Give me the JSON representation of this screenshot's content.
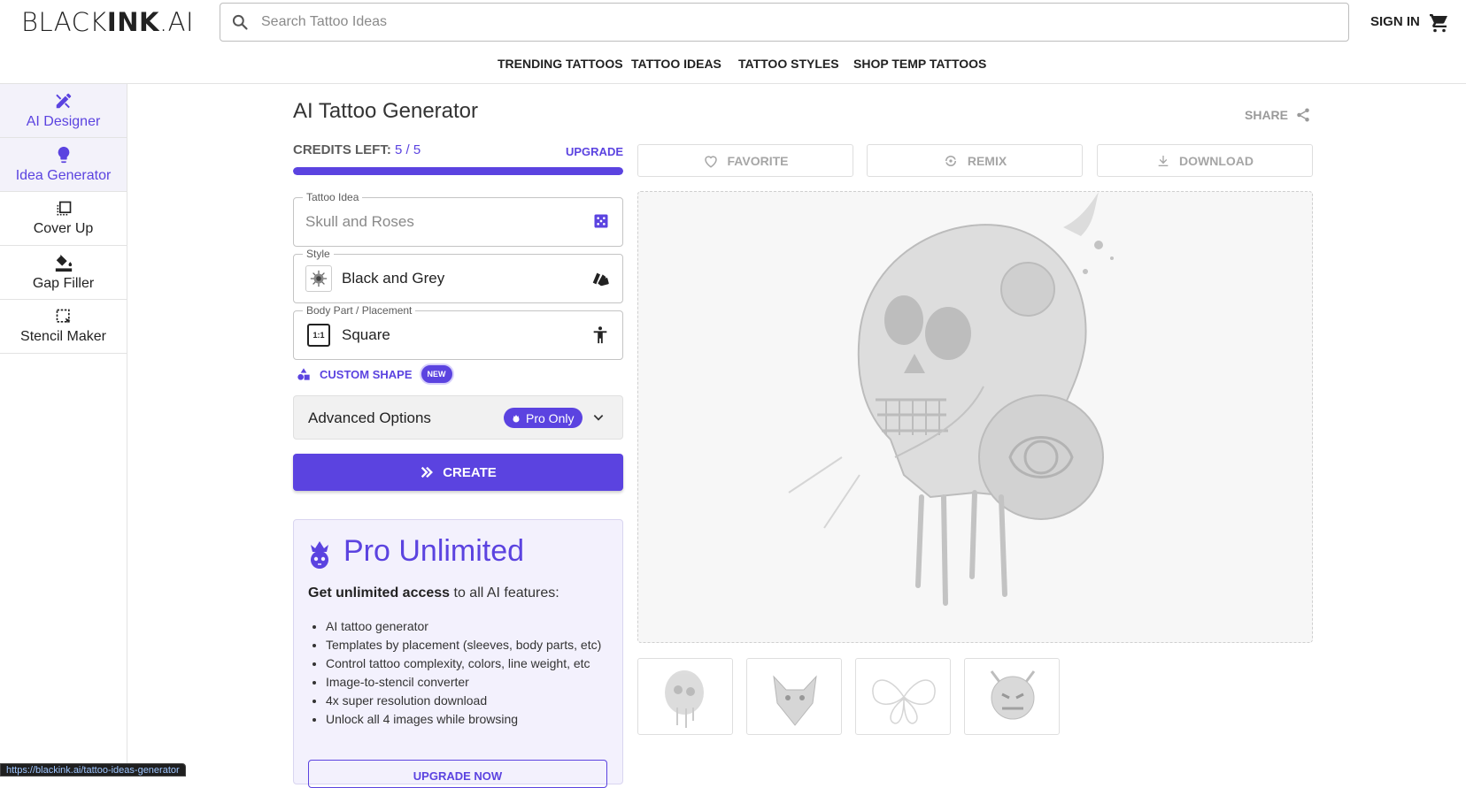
{
  "header": {
    "logo_thin": "BLACK",
    "logo_bold": "INK",
    "logo_end": ".AI",
    "search_placeholder": "Search Tattoo Ideas",
    "sign_in": "SIGN IN"
  },
  "nav": [
    "TRENDING TATTOOS",
    "TATTOO IDEAS",
    "TATTOO STYLES",
    "SHOP TEMP TATTOOS"
  ],
  "sidebar": {
    "items": [
      {
        "label": "AI Designer",
        "icon": "pencil-ruler-icon",
        "active": true
      },
      {
        "label": "Idea Generator",
        "icon": "lightbulb-icon",
        "active": false
      },
      {
        "label": "Cover Up",
        "icon": "layers-icon",
        "active": false
      },
      {
        "label": "Gap Filler",
        "icon": "paint-bucket-icon",
        "active": false
      },
      {
        "label": "Stencil Maker",
        "icon": "dashed-select-icon",
        "active": false
      }
    ]
  },
  "main": {
    "title": "AI Tattoo Generator",
    "credits_label": "CREDITS LEFT:",
    "credits_value": "5 / 5",
    "credits_fraction": 1.0,
    "upgrade": "UPGRADE",
    "fields": {
      "idea": {
        "label": "Tattoo Idea",
        "placeholder": "Skull and Roses",
        "icon": "dice-icon"
      },
      "style": {
        "label": "Style",
        "value": "Black and Grey",
        "icon": "swatches-icon"
      },
      "placement": {
        "label": "Body Part / Placement",
        "value": "Square",
        "thumb": "1:1",
        "icon": "body-icon"
      }
    },
    "custom_shape": "CUSTOM SHAPE",
    "new_badge": "NEW",
    "advanced": {
      "label": "Advanced Options",
      "chip": "Pro Only"
    },
    "create": "CREATE",
    "pro": {
      "title": "Pro Unlimited",
      "sub_bold": "Get unlimited access",
      "sub_rest": " to all AI features:",
      "features": [
        "AI tattoo generator",
        "Templates by placement (sleeves, body parts, etc)",
        "Control tattoo complexity, colors, line weight, etc",
        "Image-to-stencil converter",
        "4x super resolution download",
        "Unlock all 4 images while browsing"
      ],
      "button": "UPGRADE NOW"
    }
  },
  "right": {
    "share": "SHARE",
    "actions": [
      {
        "label": "FAVORITE",
        "icon": "heart-icon"
      },
      {
        "label": "REMIX",
        "icon": "remix-icon"
      },
      {
        "label": "DOWNLOAD",
        "icon": "download-icon"
      }
    ],
    "thumbnails": [
      "skull-thumbnail",
      "wolf-thumbnail",
      "butterfly-thumbnail",
      "demon-thumbnail"
    ]
  },
  "status_url": "https://blackink.ai/tattoo-ideas-generator",
  "colors": {
    "accent": "#5b43e0",
    "accent_light": "#f3f1fd"
  }
}
